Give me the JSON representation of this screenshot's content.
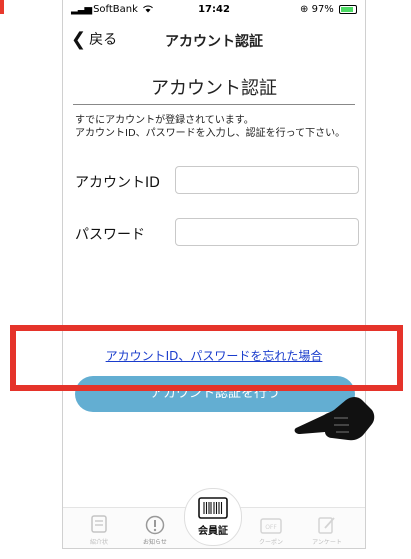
{
  "statusbar": {
    "carrier": "SoftBank",
    "time": "17:42",
    "battery": "97%"
  },
  "navbar": {
    "back_label": "戻る",
    "title": "アカウント認証"
  },
  "page": {
    "heading": "アカウント認証",
    "intro_line1": "すでにアカウントが登録されています。",
    "intro_line2": "アカウントID、パスワードを入力し、認証を行って下さい。"
  },
  "form": {
    "account_id_label": "アカウントID",
    "account_id_value": "",
    "password_label": "パスワード",
    "password_value": ""
  },
  "actions": {
    "forgot_link": "アカウントID、パスワードを忘れた場合",
    "submit_label": "アカウント認証を行う"
  },
  "tabbar": {
    "items": [
      {
        "label": "紹介状",
        "icon": "ticket-icon"
      },
      {
        "label": "お知らせ",
        "icon": "info-icon"
      },
      {
        "label": "会員証",
        "icon": "barcode-icon"
      },
      {
        "label": "クーポン",
        "icon": "coupon-icon"
      },
      {
        "label": "アンケート",
        "icon": "survey-icon"
      }
    ]
  },
  "colors": {
    "accent_button": "#63aed2",
    "link": "#1a3ccc",
    "highlight": "#e5332a",
    "battery": "#4cd964"
  }
}
